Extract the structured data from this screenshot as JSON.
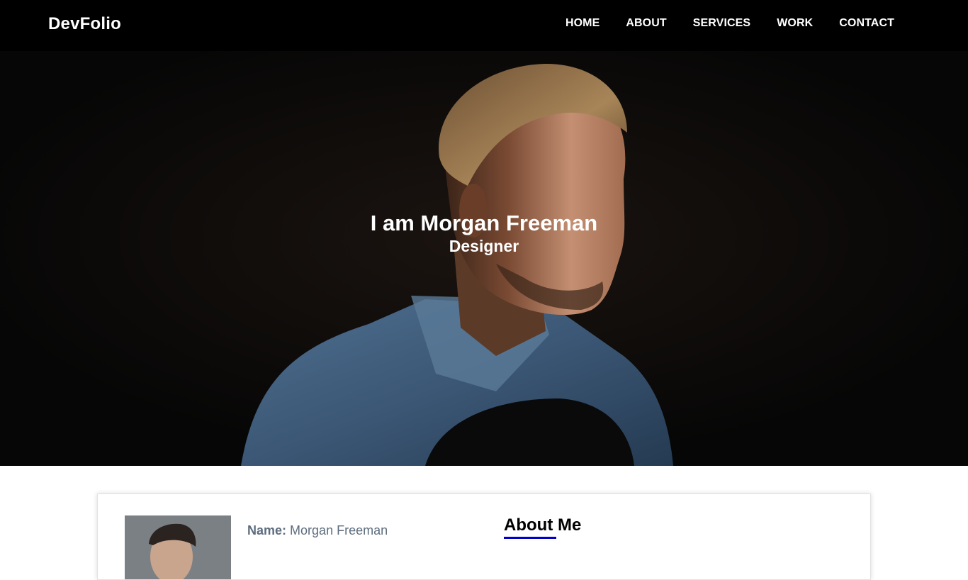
{
  "navbar": {
    "brand": "DevFolio",
    "links": [
      {
        "label": "HOME"
      },
      {
        "label": "ABOUT"
      },
      {
        "label": "SERVICES"
      },
      {
        "label": "WORK"
      },
      {
        "label": "CONTACT"
      }
    ]
  },
  "hero": {
    "title": "I am Morgan Freeman",
    "subtitle": "Designer"
  },
  "about": {
    "name_key": "Name:",
    "name_value": "Morgan Freeman",
    "heading": "About Me",
    "accent_color": "#0000c8"
  },
  "colors": {
    "navbar_bg": "#000000",
    "hero_bg": "#070707",
    "text_light": "#ffffff"
  }
}
